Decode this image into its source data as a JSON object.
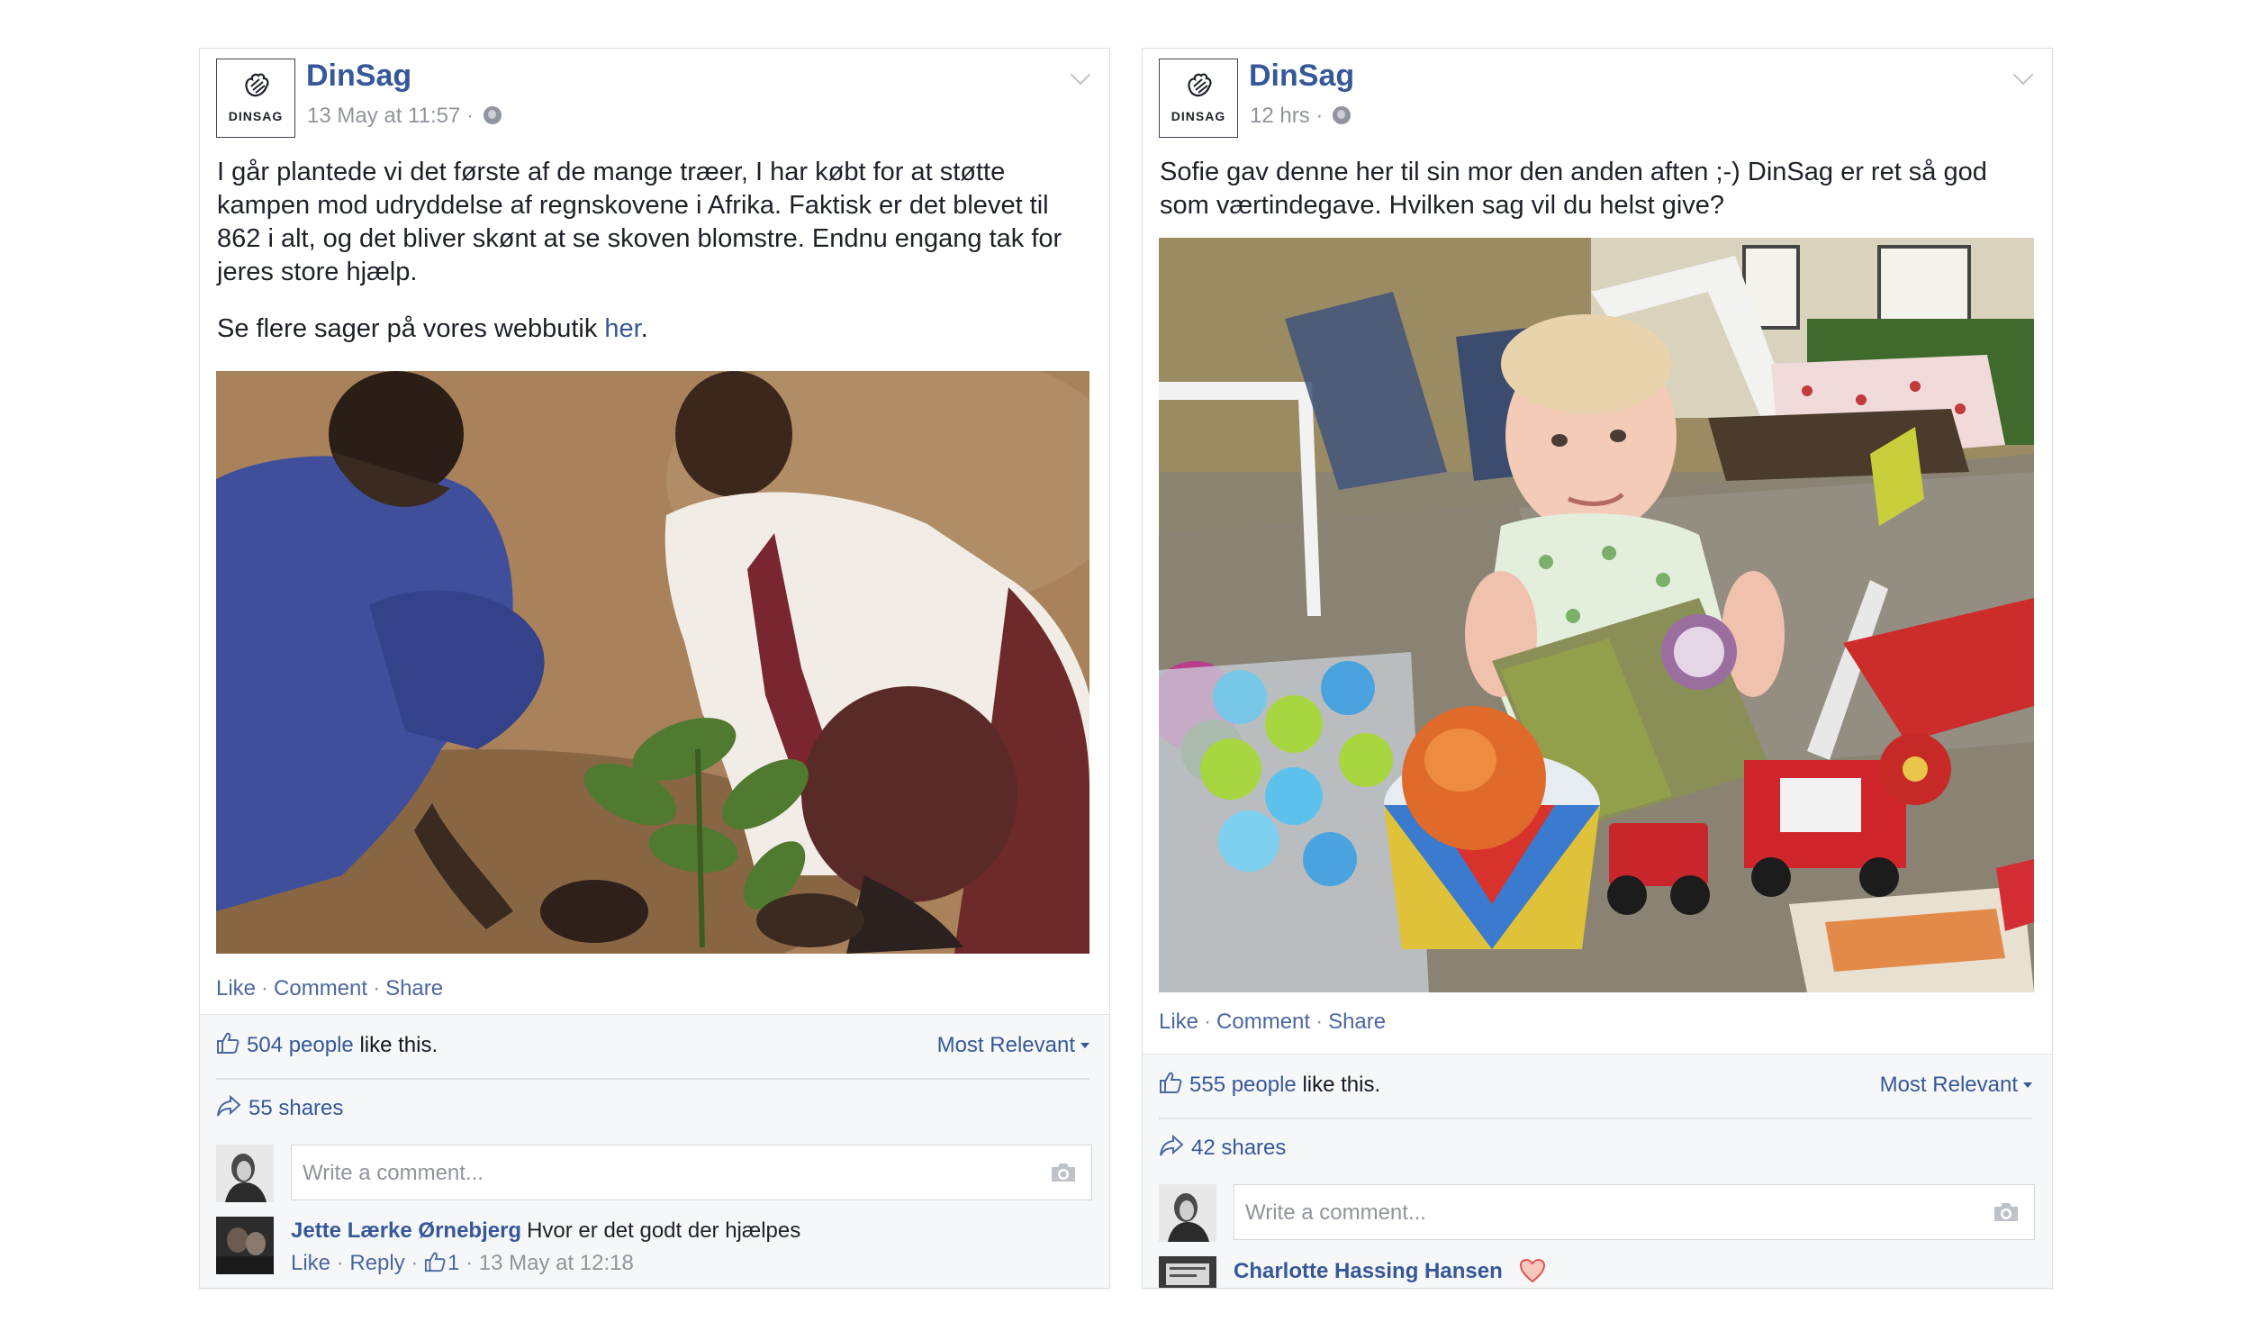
{
  "colors": {
    "link_blue": "#365899",
    "muted_gray": "#90949c",
    "ufi_background": "#f6f7f9",
    "border": "#dddfe2"
  },
  "posts": [
    {
      "page_name": "DinSag",
      "logo_text": "DINSAG",
      "timestamp": "13 May at 11:57 ·",
      "privacy_icon": "globe-icon",
      "message": "I går plantede vi det første af de mange træer, I har købt for at støtte kampen mod udryddelse af regnskovene i Afrika. Faktisk er det blevet til 862 i alt, og det bliver skønt at se skoven blomstre. Endnu engang tak for jeres store hjælp.",
      "message_2_prefix": "Se flere sager på vores webbutik ",
      "message_2_link": "her",
      "message_2_suffix": ".",
      "actions": [
        "Like",
        "Comment",
        "Share"
      ],
      "likes_count": "504 people",
      "likes_suffix": " like this.",
      "sort_label": "Most Relevant",
      "shares": "55 shares",
      "comment_placeholder": "Write a comment...",
      "comment": {
        "author": "Jette Lærke Ørnebjerg",
        "text": "Hvor er det godt der hjælpes",
        "like": "Like",
        "reply": "Reply",
        "like_count": "1",
        "time": "13 May at 12:18"
      }
    },
    {
      "page_name": "DinSag",
      "logo_text": "DINSAG",
      "timestamp": "12 hrs ·",
      "privacy_icon": "globe-icon",
      "message": "Sofie gav denne her til sin mor den anden aften ;-) DinSag er ret så god som værtindegave. Hvilken sag vil du helst give?",
      "actions": [
        "Like",
        "Comment",
        "Share"
      ],
      "likes_count": "555 people",
      "likes_suffix": " like this.",
      "sort_label": "Most Relevant",
      "shares": "42 shares",
      "comment_placeholder": "Write a comment...",
      "comment": {
        "author": "Charlotte Hassing Hansen",
        "reaction_icon": "heart-icon"
      }
    }
  ]
}
